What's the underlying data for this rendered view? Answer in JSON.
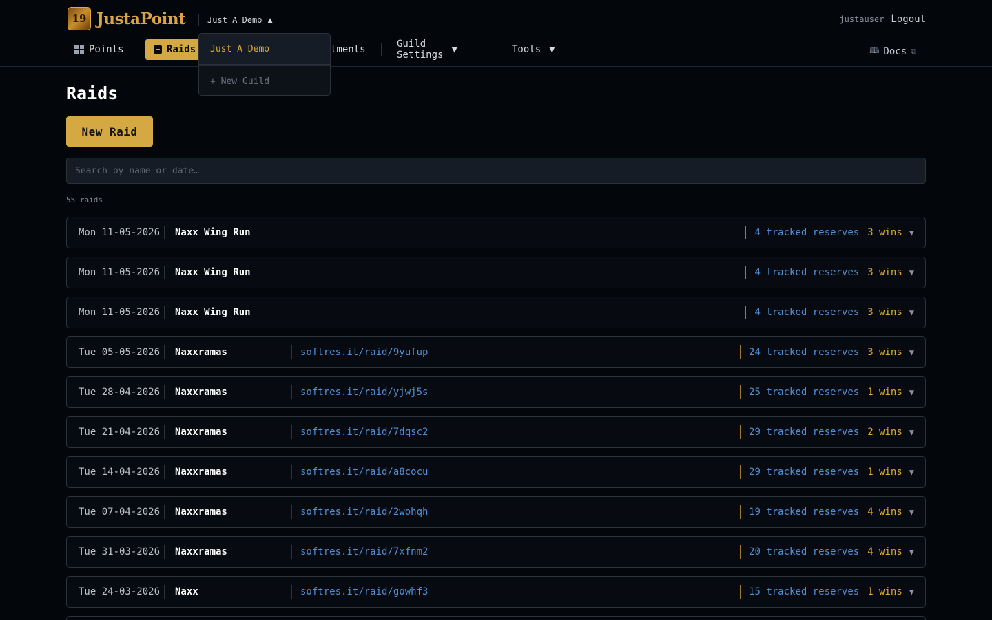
{
  "app": {
    "logo_glyph": "19",
    "logo_text": "JustaPoint"
  },
  "guild_selector": {
    "current": "Just A Demo",
    "caret": "▲"
  },
  "user": {
    "name": "justauser",
    "logout": "Logout"
  },
  "nav": {
    "points": "Points",
    "raids": "Raids",
    "adjustments_partial": "tments",
    "guild_settings": "Guild Settings",
    "tools": "Tools",
    "caret": "▼",
    "docs": "Docs",
    "docs_book": "🕮",
    "docs_ext": "⧉"
  },
  "guild_dropdown": {
    "items": [
      "Just A Demo"
    ],
    "new_guild": "+ New Guild"
  },
  "page": {
    "title": "Raids",
    "new_raid": "New Raid",
    "search_placeholder": "Search by name or date…",
    "count": "55 raids"
  },
  "raids": [
    {
      "date": "Mon 11-05-2026",
      "name": "Naxx Wing Run",
      "link": "",
      "reserves": "4 tracked reserves",
      "wins": "3 wins"
    },
    {
      "date": "Mon 11-05-2026",
      "name": "Naxx Wing Run",
      "link": "",
      "reserves": "4 tracked reserves",
      "wins": "3 wins"
    },
    {
      "date": "Mon 11-05-2026",
      "name": "Naxx Wing Run",
      "link": "",
      "reserves": "4 tracked reserves",
      "wins": "3 wins"
    },
    {
      "date": "Tue 05-05-2026",
      "name": "Naxxramas",
      "link": "softres.it/raid/9yufup",
      "reserves": "24 tracked reserves",
      "wins": "3 wins"
    },
    {
      "date": "Tue 28-04-2026",
      "name": "Naxxramas",
      "link": "softres.it/raid/yjwj5s",
      "reserves": "25 tracked reserves",
      "wins": "1 wins"
    },
    {
      "date": "Tue 21-04-2026",
      "name": "Naxxramas",
      "link": "softres.it/raid/7dqsc2",
      "reserves": "29 tracked reserves",
      "wins": "2 wins"
    },
    {
      "date": "Tue 14-04-2026",
      "name": "Naxxramas",
      "link": "softres.it/raid/a8cocu",
      "reserves": "29 tracked reserves",
      "wins": "1 wins"
    },
    {
      "date": "Tue 07-04-2026",
      "name": "Naxxramas",
      "link": "softres.it/raid/2wohqh",
      "reserves": "19 tracked reserves",
      "wins": "4 wins"
    },
    {
      "date": "Tue 31-03-2026",
      "name": "Naxxramas",
      "link": "softres.it/raid/7xfnm2",
      "reserves": "20 tracked reserves",
      "wins": "4 wins"
    },
    {
      "date": "Tue 24-03-2026",
      "name": "Naxx",
      "link": "softres.it/raid/gowhf3",
      "reserves": "15 tracked reserves",
      "wins": "1 wins"
    }
  ],
  "row_caret": "▼"
}
